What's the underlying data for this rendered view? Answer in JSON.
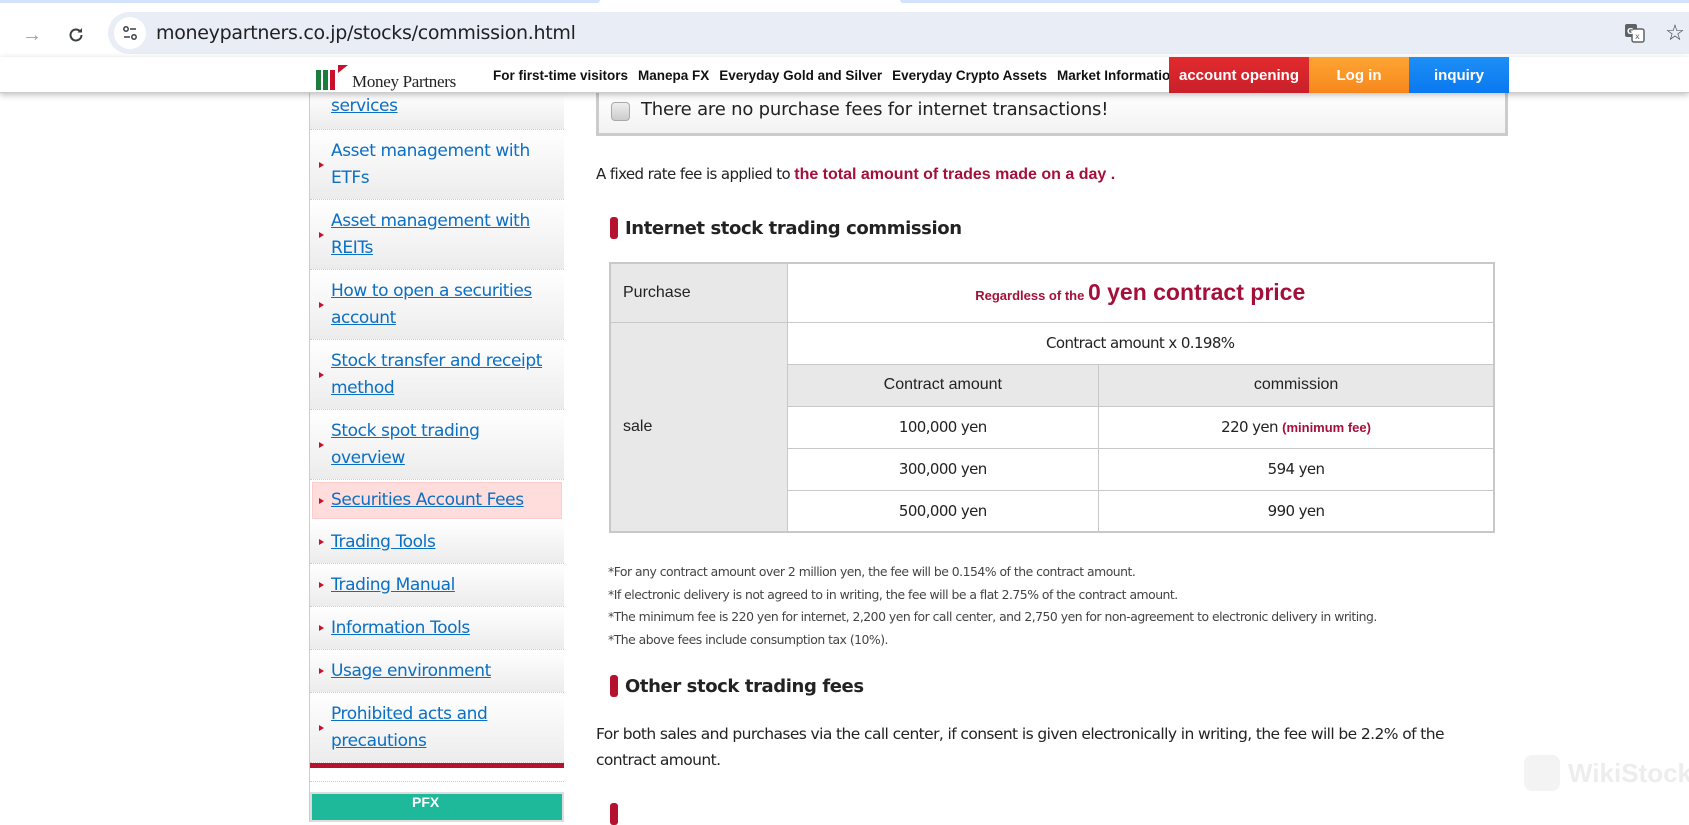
{
  "browser": {
    "url": "moneypartners.co.jp/stocks/commission.html",
    "icons": [
      "forward-icon",
      "reload-icon",
      "site-info-icon",
      "translate-icon",
      "bookmark-star-icon"
    ]
  },
  "header": {
    "logo_text": "Money Partners",
    "nav": [
      "For first-time visitors",
      "Manepa FX",
      "Everyday Gold and Silver",
      "Everyday Crypto Assets",
      "Market Information"
    ],
    "buttons": {
      "account_opening": "account opening",
      "login": "Log in",
      "inquiry": "inquiry"
    },
    "colors": {
      "account_opening": "#d8262c",
      "login": "#f7921e",
      "inquiry": "#0a84f5"
    }
  },
  "sidebar": {
    "items": [
      {
        "label": "services"
      },
      {
        "label": "Asset management with ETFs"
      },
      {
        "label": "Asset management with REITs"
      },
      {
        "label": "How to open a securities account"
      },
      {
        "label": "Stock transfer and receipt method"
      },
      {
        "label": "Stock spot trading overview"
      },
      {
        "label": "Securities Account Fees",
        "active": true
      },
      {
        "label": "Trading Tools"
      },
      {
        "label": "Trading Manual"
      },
      {
        "label": "Information Tools"
      },
      {
        "label": "Usage environment"
      },
      {
        "label": "Prohibited acts and precautions"
      }
    ],
    "banner_text": "PFX"
  },
  "main": {
    "notice": "There are no purchase fees for internet transactions!",
    "intro_prefix": "A fixed rate fee is applied to ",
    "intro_highlight": "the total amount of trades made on a day .",
    "section1_title": "Internet stock trading commission",
    "table": {
      "purchase_label": "Purchase",
      "purchase_small": "Regardless of the ",
      "purchase_large": "0 yen contract price",
      "sale_label": "sale",
      "sale_formula": "Contract amount x 0.198%",
      "col_headers": [
        "Contract amount",
        "commission"
      ],
      "rows": [
        {
          "amount": "100,000 yen",
          "commission": "220 yen",
          "note": "(minimum fee)"
        },
        {
          "amount": "300,000 yen",
          "commission": "594 yen",
          "note": ""
        },
        {
          "amount": "500,000 yen",
          "commission": "990 yen",
          "note": ""
        }
      ]
    },
    "notes": [
      "*For any contract amount over 2 million yen, the fee will be 0.154% of the contract amount.",
      "*If electronic delivery is not agreed to in writing, the fee will be a flat 2.75% of the contract amount.",
      "*The minimum fee is 220 yen for internet, 2,200 yen for call center, and 2,750 yen for non-agreement to electronic delivery in writing.",
      "*The above fees include consumption tax (10%)."
    ],
    "section2_title": "Other stock trading fees",
    "section2_paragraph": "For both sales and purchases via the call center, if consent is given electronically in writing, the fee will be 2.2% of the contract amount.",
    "accent_color": "#a5103a"
  },
  "watermark": "WikiStock"
}
